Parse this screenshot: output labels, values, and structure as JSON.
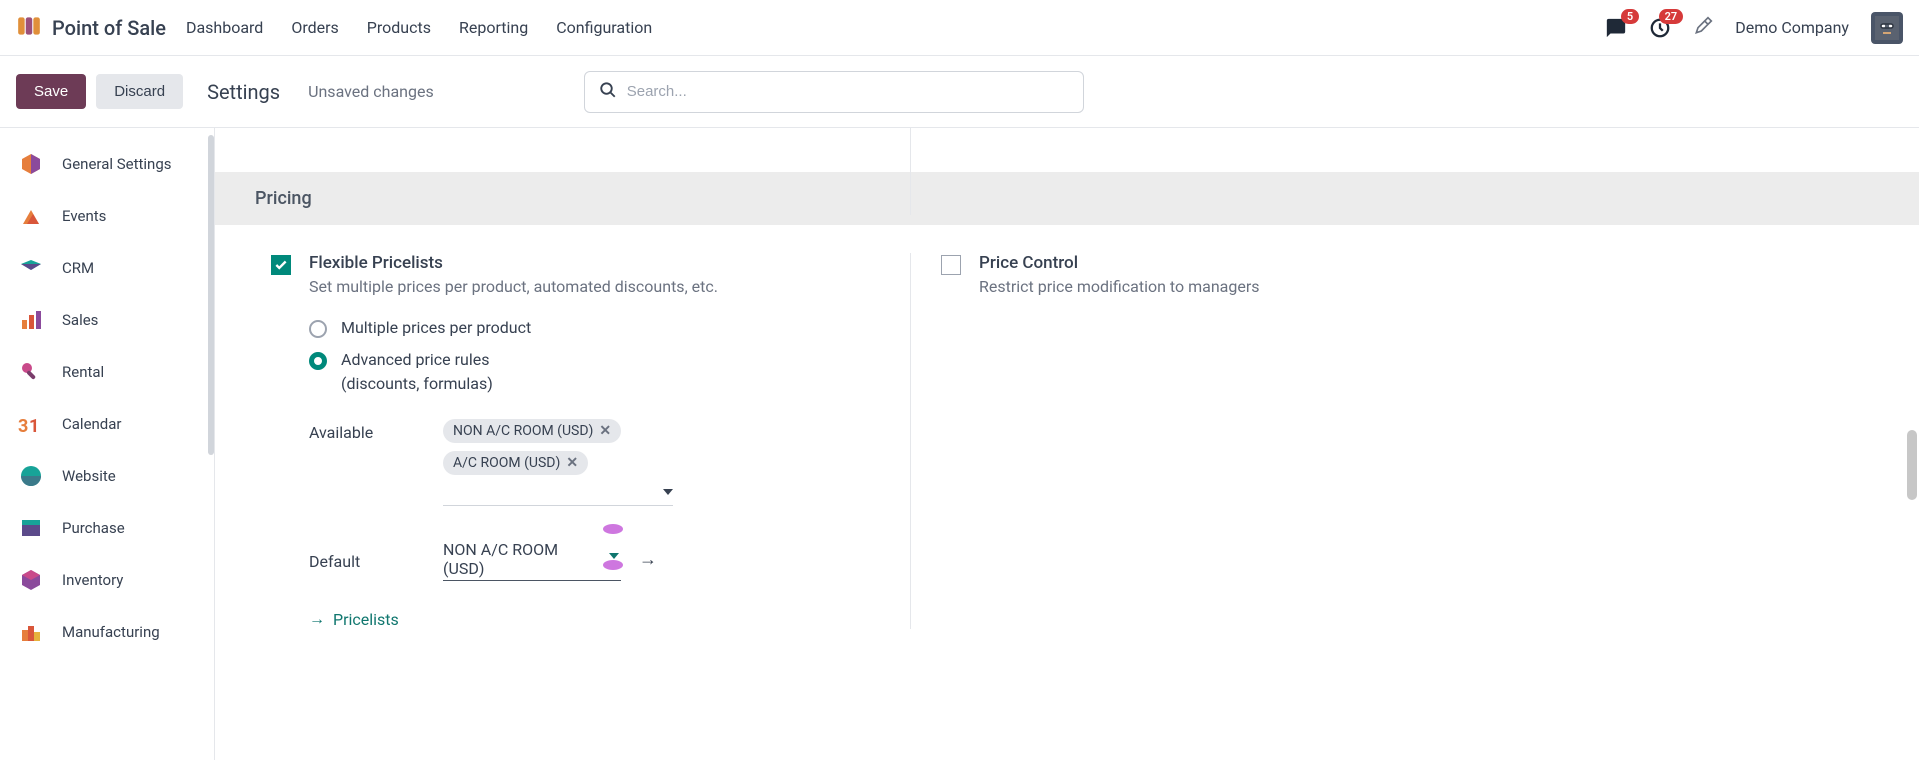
{
  "app_title": "Point of Sale",
  "topnav": [
    "Dashboard",
    "Orders",
    "Products",
    "Reporting",
    "Configuration"
  ],
  "badges": {
    "messages": "5",
    "activities": "27"
  },
  "company": "Demo Company",
  "actions": {
    "save": "Save",
    "discard": "Discard"
  },
  "page_title": "Settings",
  "unsaved": "Unsaved changes",
  "search_placeholder": "Search...",
  "sidebar": [
    {
      "label": "General Settings"
    },
    {
      "label": "Events"
    },
    {
      "label": "CRM"
    },
    {
      "label": "Sales"
    },
    {
      "label": "Rental"
    },
    {
      "label": "Calendar"
    },
    {
      "label": "Website"
    },
    {
      "label": "Purchase"
    },
    {
      "label": "Inventory"
    },
    {
      "label": "Manufacturing"
    }
  ],
  "section_title": "Pricing",
  "flexible": {
    "title": "Flexible Pricelists",
    "desc": "Set multiple prices per product, automated discounts, etc.",
    "radio1": "Multiple prices per product",
    "radio2": "Advanced price rules",
    "radio2_sub": "(discounts, formulas)",
    "available_label": "Available",
    "tags": [
      "NON A/C ROOM (USD)",
      "A/C ROOM (USD)"
    ],
    "default_label": "Default",
    "default_value": "NON A/C ROOM (USD)",
    "pricelists_link": "Pricelists"
  },
  "price_control": {
    "title": "Price Control",
    "desc": "Restrict price modification to managers"
  }
}
